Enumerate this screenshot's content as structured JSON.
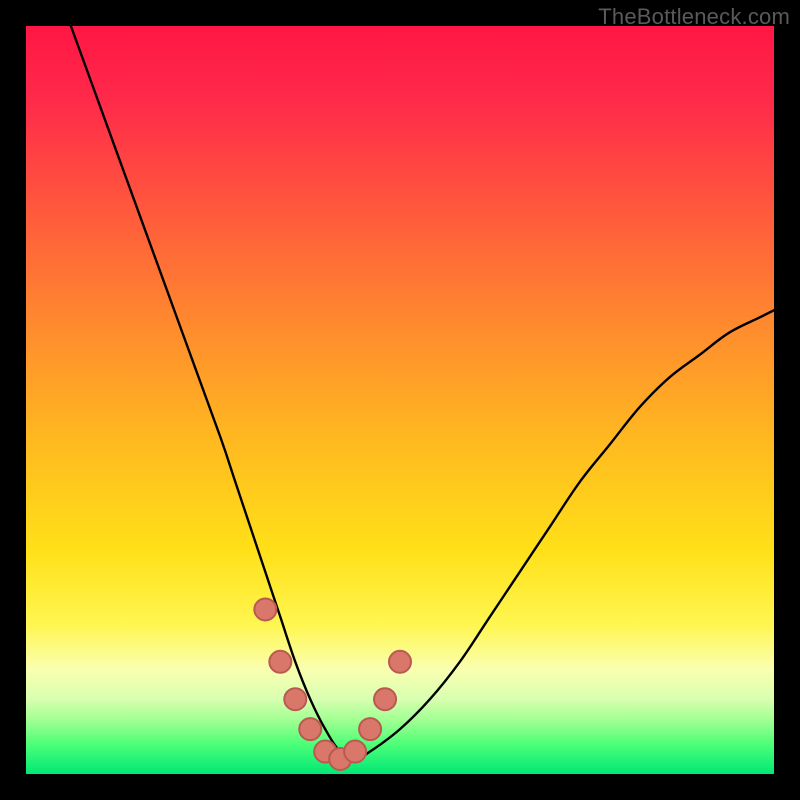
{
  "watermark": {
    "text": "TheBottleneck.com"
  },
  "colors": {
    "gradient_stops": [
      {
        "offset": 0.0,
        "color": "#ff1744"
      },
      {
        "offset": 0.1,
        "color": "#ff2a4a"
      },
      {
        "offset": 0.25,
        "color": "#ff5a3c"
      },
      {
        "offset": 0.4,
        "color": "#ff8a2e"
      },
      {
        "offset": 0.55,
        "color": "#ffb820"
      },
      {
        "offset": 0.7,
        "color": "#ffe018"
      },
      {
        "offset": 0.8,
        "color": "#fff650"
      },
      {
        "offset": 0.86,
        "color": "#faffb0"
      },
      {
        "offset": 0.9,
        "color": "#d8ffb0"
      },
      {
        "offset": 0.93,
        "color": "#9cff90"
      },
      {
        "offset": 0.96,
        "color": "#4dff78"
      },
      {
        "offset": 1.0,
        "color": "#00e876"
      }
    ],
    "curve": "#000000",
    "marker_fill": "#d9786a",
    "marker_stroke": "#b85a50"
  },
  "chart_data": {
    "type": "line",
    "title": "",
    "xlabel": "",
    "ylabel": "",
    "xlim": [
      0,
      100
    ],
    "ylim": [
      0,
      100
    ],
    "grid": false,
    "series": [
      {
        "name": "bottleneck-curve",
        "x": [
          6,
          10,
          14,
          18,
          22,
          26,
          28,
          30,
          32,
          34,
          36,
          38,
          40,
          42,
          44,
          46,
          50,
          54,
          58,
          62,
          66,
          70,
          74,
          78,
          82,
          86,
          90,
          94,
          98,
          100
        ],
        "values": [
          100,
          89,
          78,
          67,
          56,
          45,
          39,
          33,
          27,
          21,
          15,
          10,
          6,
          3,
          2,
          3,
          6,
          10,
          15,
          21,
          27,
          33,
          39,
          44,
          49,
          53,
          56,
          59,
          61,
          62
        ]
      }
    ],
    "markers": {
      "name": "highlight-points",
      "x": [
        32,
        34,
        36,
        38,
        40,
        42,
        44,
        46,
        48,
        50
      ],
      "values": [
        22,
        15,
        10,
        6,
        3,
        2,
        3,
        6,
        10,
        15
      ]
    }
  }
}
